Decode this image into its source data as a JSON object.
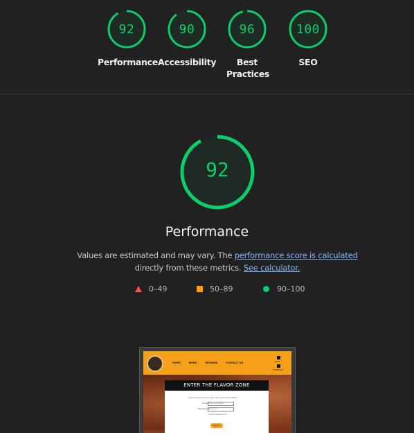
{
  "colors": {
    "background": "#212121",
    "pass": "#0cce6b",
    "average": "#ffa400",
    "fail": "#ff4e42",
    "link": "#8ab4f8"
  },
  "summary_gauges": [
    {
      "score": "92",
      "label": "Performance",
      "value": 92
    },
    {
      "score": "90",
      "label": "Accessibility",
      "value": 90
    },
    {
      "score": "96",
      "label": "Best Practices",
      "value": 96
    },
    {
      "score": "100",
      "label": "SEO",
      "value": 100
    }
  ],
  "main_gauge": {
    "score": "92",
    "value": 92,
    "title": "Performance"
  },
  "description": {
    "text_before": "Values are estimated and may vary. The ",
    "link1": "performance score is calculated",
    "text_middle": " directly from these metrics. ",
    "link2": "See calculator."
  },
  "legend": [
    {
      "shape": "triangle",
      "range": "0–49",
      "color": "#ff4e42"
    },
    {
      "shape": "square",
      "range": "50–89",
      "color": "#ffa400"
    },
    {
      "shape": "circle",
      "range": "90–100",
      "color": "#0cce6b"
    }
  ],
  "thumbnail": {
    "nav_links": [
      "HOME",
      "MENU",
      "REVIEWS",
      "CONTACT US"
    ],
    "nav_icons": [
      "LOGIN",
      "DOWNLOAD"
    ],
    "card_title": "ENTER THE FLAVOR ZONE",
    "card_subtitle": "If you have an account, log in with your email address.",
    "field_email_label": "Email",
    "field_email_placeholder": "Enter your email",
    "field_password_label": "Password",
    "field_password_placeholder": "Password",
    "forgot_link": "Forgot Password?",
    "sign_in_button": "Sign In"
  }
}
